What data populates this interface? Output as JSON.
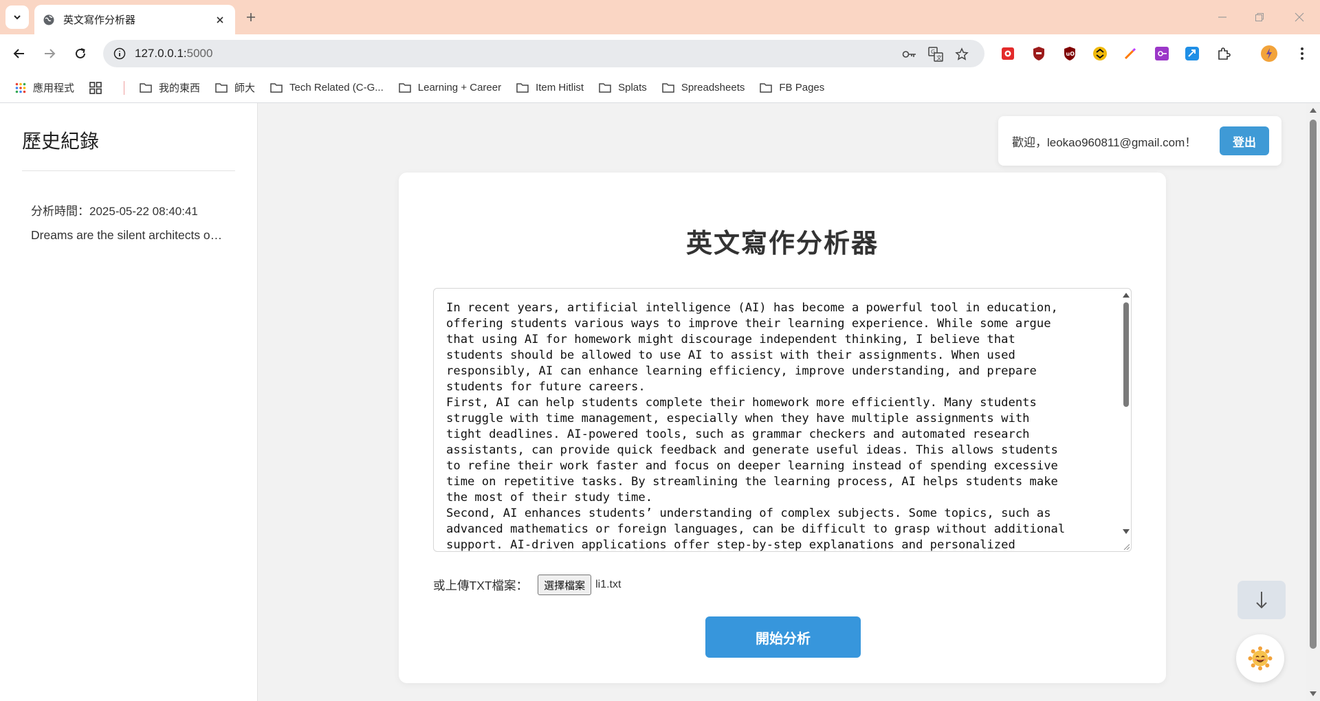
{
  "browser": {
    "tab_title": "英文寫作分析器",
    "url_host": "127.0.0.1:",
    "url_port": "5000"
  },
  "bookmarks": [
    {
      "label": "應用程式",
      "icon": "apps-grid-icon"
    },
    {
      "label": "",
      "icon": "app-grid-icon"
    },
    {
      "label": "我的東西",
      "icon": "folder-icon"
    },
    {
      "label": "師大",
      "icon": "folder-icon"
    },
    {
      "label": "Tech Related (C-G...",
      "icon": "folder-icon"
    },
    {
      "label": "Learning + Career",
      "icon": "folder-icon"
    },
    {
      "label": "Item Hitlist",
      "icon": "folder-icon"
    },
    {
      "label": "Splats",
      "icon": "folder-icon"
    },
    {
      "label": "Spreadsheets",
      "icon": "folder-icon"
    },
    {
      "label": "FB Pages",
      "icon": "folder-icon"
    }
  ],
  "sidebar": {
    "title": "歷史紀錄",
    "items": [
      {
        "time": "分析時間：2025-05-22 08:40:41",
        "snippet": "Dreams are the silent architects of our future"
      }
    ]
  },
  "header": {
    "welcome": "歡迎，leokao960811@gmail.com！",
    "logout_label": "登出"
  },
  "main": {
    "title": "英文寫作分析器",
    "essay_text": "In recent years, artificial intelligence (AI) has become a powerful tool in education,\noffering students various ways to improve their learning experience. While some argue\nthat using AI for homework might discourage independent thinking, I believe that\nstudents should be allowed to use AI to assist with their assignments. When used\nresponsibly, AI can enhance learning efficiency, improve understanding, and prepare\nstudents for future careers.\nFirst, AI can help students complete their homework more efficiently. Many students\nstruggle with time management, especially when they have multiple assignments with\ntight deadlines. AI-powered tools, such as grammar checkers and automated research\nassistants, can provide quick feedback and generate useful ideas. This allows students\nto refine their work faster and focus on deeper learning instead of spending excessive\ntime on repetitive tasks. By streamlining the learning process, AI helps students make\nthe most of their study time.\nSecond, AI enhances students’ understanding of complex subjects. Some topics, such as\nadvanced mathematics or foreign languages, can be difficult to grasp without additional\nsupport. AI-driven applications offer step-by-step explanations and personalized",
    "upload_label": "或上傳TXT檔案：",
    "file_button_label": "選擇檔案",
    "file_name": "li1.txt",
    "analyze_label": "開始分析"
  },
  "colors": {
    "tabbar": "#fad6c4",
    "accent": "#3796dc",
    "logout": "#3f9ad6"
  }
}
